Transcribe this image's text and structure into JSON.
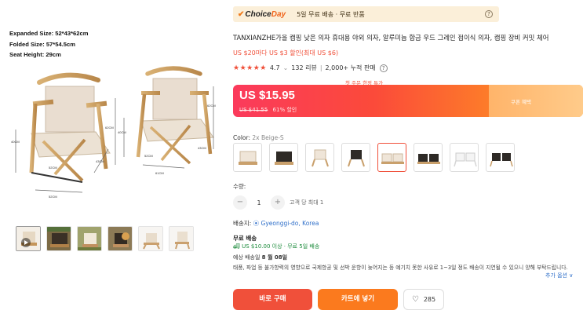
{
  "gallery": {
    "specs": [
      "Expanded Size: 52*43*62cm",
      "Folded Size: 57*54.5cm",
      "Seat Height: 29cm"
    ],
    "dims": [
      "52CM",
      "43CM",
      "62CM",
      "40CM",
      "52CM",
      "61CM",
      "43CM",
      "62CM",
      "40CM",
      "52CM"
    ],
    "thumb_count": 6
  },
  "choice": {
    "logo_part1": "Choice",
    "logo_part2": "Day",
    "text": "5일 무료 배송 · 무료 반품",
    "help": "?"
  },
  "product": {
    "title": "TANXIANZHE가을 캠핑 낮은 의자 휴대용 야외 의자, 알루미늄 합금 우드 그레인 접이식 의자, 캠핑 장비 커밋 체어",
    "promo": "US $20마다 US $3 할인(최대 US $6)",
    "stars": "★★★★★",
    "rating": "4.7",
    "reviews": "132 리뷰",
    "sold": "2,000+ 누적 판매",
    "help": "?"
  },
  "price": {
    "first_order": "첫 주문 한정 특가",
    "current": "US $15.95",
    "original": "US $41.55",
    "discount": "61% 할인",
    "coupon": "쿠폰 혜택"
  },
  "color": {
    "label": "Color:",
    "value": "2x Beige-S",
    "swatch_count": 8,
    "selected_index": 4
  },
  "quantity": {
    "label": "수량:",
    "minus": "−",
    "value": "1",
    "plus": "+",
    "limit": "고객 당 최대 1"
  },
  "shipping": {
    "label": "배송지:",
    "location": "Gyeonggi-do, Korea",
    "free_title": "무료 배송",
    "free_sub": "US $10.00 이상 · 무료 5일 배송",
    "arrival_prefix": "예상 배송일",
    "arrival_date": "8 월 08일",
    "notice": "태풍, 파업 등 불가항력의 영향으로 국제항공 및 선박 운항이 늦어지는 등 예기치 못한 사유로 1~3일 정도 배송이 지연될 수 있으니 양해 부탁드립니다.",
    "more": "추가 옵션 ∨"
  },
  "actions": {
    "buy": "바로 구매",
    "cart": "카트에 넣기",
    "wish_count": "285"
  },
  "colors": {
    "accent": "#f0503a",
    "cart": "#fb7a1e",
    "choice_bg": "#fbefd9",
    "link": "#2f6fc9",
    "ship_green": "#1a8a3a"
  }
}
